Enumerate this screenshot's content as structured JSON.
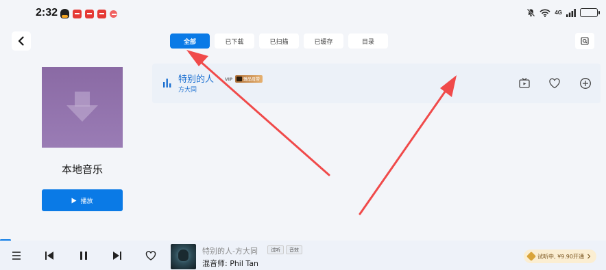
{
  "status_bar": {
    "time": "2:32",
    "network": "4G",
    "icons": [
      "qq-icon",
      "app-notification-icon",
      "app-notification-icon",
      "app-notification-icon",
      "app-notification-icon",
      "mute-icon",
      "wifi-icon",
      "signal-icon",
      "battery-icon"
    ]
  },
  "header": {
    "back_icon": "chevron-left-icon",
    "tabs": [
      {
        "label": "全部",
        "active": true
      },
      {
        "label": "已下载",
        "active": false
      },
      {
        "label": "已扫描",
        "active": false
      },
      {
        "label": "已缓存",
        "active": false
      },
      {
        "label": "目录",
        "active": false
      }
    ],
    "search_icon": "search-icon"
  },
  "album": {
    "title": "本地音乐",
    "play_label": "播放",
    "cover_icon": "download-arrow-icon"
  },
  "song": {
    "title": "特别的人",
    "artist": "方大同",
    "vip_text": "VIP",
    "quality_text": "臻品母带",
    "actions": [
      "mv-icon",
      "heart-icon",
      "add-icon"
    ]
  },
  "player": {
    "now_playing_title": "特别的人-方大同",
    "badges": [
      "试听",
      "音效"
    ],
    "mixer_line": "混音师:  Phil Tan",
    "trial_text": "试听中, ¥9.90开通",
    "controls": [
      "menu-icon",
      "previous-icon",
      "pause-icon",
      "next-icon",
      "heart-icon"
    ]
  },
  "colors": {
    "accent": "#0a7ae6",
    "annotation_arrow": "#f04a4a",
    "cover": "#9a7cb5"
  }
}
